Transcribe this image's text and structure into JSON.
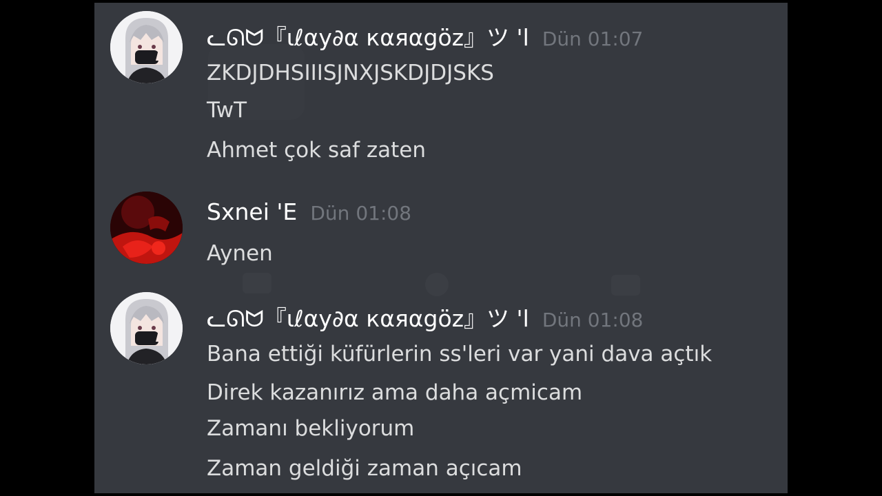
{
  "messages": [
    {
      "author": "ᓚᘏᗢ『ιℓαу∂α кαяαgöz』ツ 'l",
      "time": "Dün 01:07",
      "avatar": "anime-girl-avatar",
      "lines": [
        "ZKDJDHSIIISJNXJSKDJDJSKS",
        "TwT",
        "Ahmet çok saf zaten"
      ]
    },
    {
      "author": "Sxnei 'E",
      "time": "Dün 01:08",
      "avatar": "red-dark-avatar",
      "lines": [
        "Aynen"
      ]
    },
    {
      "author": "ᓚᘏᗢ『ιℓαу∂α кαяαgöz』ツ 'l",
      "time": "Dün 01:08",
      "avatar": "anime-girl-avatar",
      "lines": [
        "Bana ettiği küfürlerin ss'leri var yani dava açtık",
        "Direk kazanırız ama daha açmicam",
        "Zamanı bekliyorum",
        "Zaman geldiği zaman açıcam"
      ]
    }
  ],
  "colors": {
    "background": "#36393f",
    "username": "#ffffff",
    "timestamp": "#72767d",
    "message_text": "#dcddde"
  }
}
